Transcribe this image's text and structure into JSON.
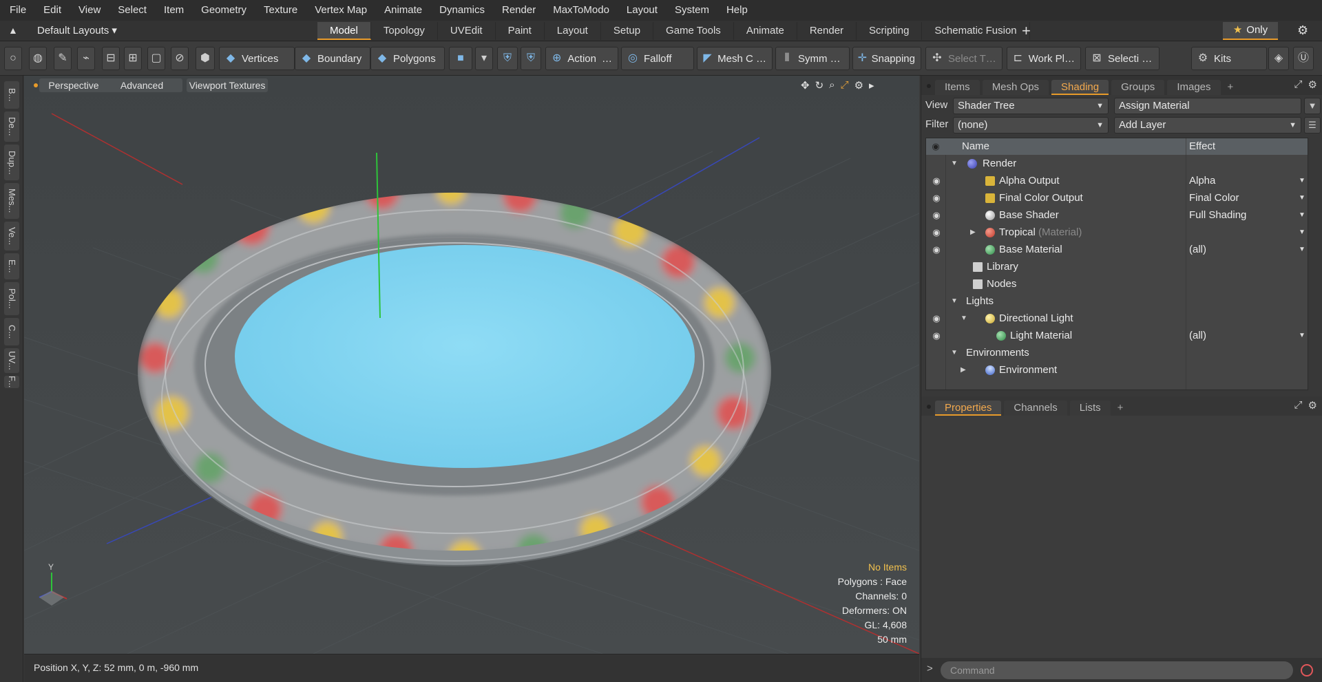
{
  "menu": [
    "File",
    "Edit",
    "View",
    "Select",
    "Item",
    "Geometry",
    "Texture",
    "Vertex Map",
    "Animate",
    "Dynamics",
    "Render",
    "MaxToModo",
    "Layout",
    "System",
    "Help"
  ],
  "layout_selector": "Default Layouts ▾",
  "layout_tabs": [
    "Model",
    "Topology",
    "UVEdit",
    "Paint",
    "Layout",
    "Setup",
    "Game Tools",
    "Animate",
    "Render",
    "Scripting",
    "Schematic Fusion"
  ],
  "layout_tab_active": "Model",
  "only_label": "Only",
  "toolbar": {
    "vertices": "Vertices",
    "boundary": "Boundary",
    "polygons": "Polygons",
    "action": "Action",
    "action_more": "…",
    "falloff": "Falloff",
    "mesh_c": "Mesh C …",
    "symm": "Symm …",
    "snapping": "Snapping",
    "select_t": "Select T…",
    "work_pl": "Work Pl…",
    "selecti": "Selecti …",
    "kits": "Kits"
  },
  "left_tabs": [
    "B...",
    "De...",
    "Dup...",
    "Mes...",
    "Ve...",
    "E...",
    "Pol...",
    "C...",
    "UV...",
    "F..."
  ],
  "viewport": {
    "buttons": [
      "Perspective",
      "Advanced",
      "Viewport Textures"
    ],
    "info": {
      "warning": "No Items",
      "lines": [
        "Polygons : Face",
        "Channels: 0",
        "Deformers: ON",
        "GL: 4,608",
        "50 mm"
      ]
    },
    "axis_y": "Y"
  },
  "status_bar": "Position X, Y, Z:   52 mm, 0 m, -960 mm",
  "shader_panel": {
    "tabs": [
      "Items",
      "Mesh Ops",
      "Shading",
      "Groups",
      "Images"
    ],
    "active_tab": "Shading",
    "view_label": "View",
    "view_value": "Shader Tree",
    "assign_material": "Assign Material",
    "filter_label": "Filter",
    "filter_value": "(none)",
    "add_layer": "Add Layer",
    "col_name": "Name",
    "col_effect": "Effect",
    "rows": [
      {
        "name": "Render",
        "sub": "",
        "effect": "",
        "icon_color": "#5a5fd6"
      },
      {
        "name": "Alpha Output",
        "sub": "",
        "effect": "Alpha",
        "icon_color": "#d9b43a"
      },
      {
        "name": "Final Color Output",
        "sub": "",
        "effect": "Final Color",
        "icon_color": "#d9b43a"
      },
      {
        "name": "Base Shader",
        "sub": "",
        "effect": "Full Shading",
        "icon_color": "#d8d8d8"
      },
      {
        "name": "Tropical",
        "sub": "(Material)",
        "effect": "",
        "icon_color": "#d84b3b"
      },
      {
        "name": "Base Material",
        "sub": "",
        "effect": "(all)",
        "icon_color": "#4caf6a"
      },
      {
        "name": "Library",
        "sub": "",
        "effect": "",
        "icon_color": "#cfcfcf"
      },
      {
        "name": "Nodes",
        "sub": "",
        "effect": "",
        "icon_color": "#cfcfcf"
      },
      {
        "name": "Lights",
        "sub": "",
        "effect": "",
        "icon_color": ""
      },
      {
        "name": "Directional Light",
        "sub": "",
        "effect": "",
        "icon_color": "#e8d04e"
      },
      {
        "name": "Light Material",
        "sub": "",
        "effect": "(all)",
        "icon_color": "#4caf6a"
      },
      {
        "name": "Environments",
        "sub": "",
        "effect": "",
        "icon_color": ""
      },
      {
        "name": "Environment",
        "sub": "",
        "effect": "",
        "icon_color": "#6f8fe0"
      }
    ]
  },
  "properties_panel": {
    "tabs": [
      "Properties",
      "Channels",
      "Lists"
    ],
    "active_tab": "Properties"
  },
  "command_placeholder": "Command",
  "colors": {
    "accent": "#e89b2a",
    "water": "#86d8f2",
    "viewport_bg": "#434749"
  }
}
